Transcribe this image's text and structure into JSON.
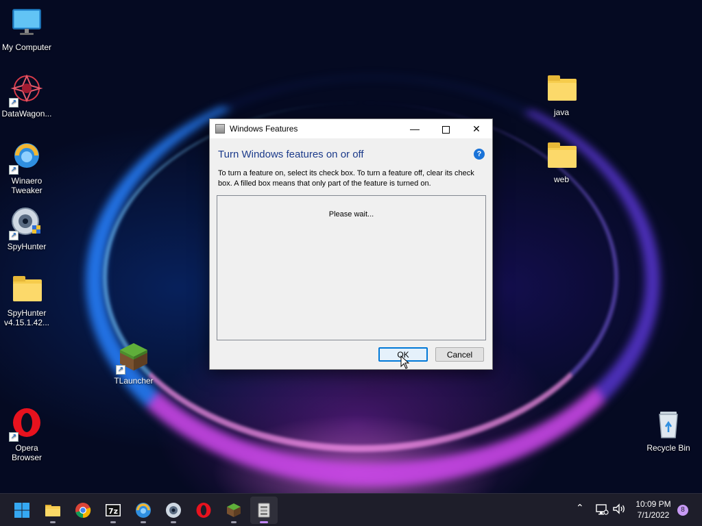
{
  "desktop": {
    "icons": [
      {
        "label": "My Computer",
        "icon": "monitor-icon"
      },
      {
        "label": "DataWagon...",
        "icon": "datawagon-icon"
      },
      {
        "label": "Winaero Tweaker",
        "icon": "winaero-icon"
      },
      {
        "label": "SpyHunter",
        "icon": "spyhunter-icon"
      },
      {
        "label": "SpyHunter v4.15.1.42...",
        "icon": "folder-icon"
      },
      {
        "label": "TLauncher",
        "icon": "grass-block-icon"
      },
      {
        "label": "Opera Browser",
        "icon": "opera-icon"
      },
      {
        "label": "java",
        "icon": "folder-icon"
      },
      {
        "label": "web",
        "icon": "folder-icon"
      },
      {
        "label": "Recycle Bin",
        "icon": "recycle-bin-icon"
      }
    ]
  },
  "dialog": {
    "title": "Windows Features",
    "heading": "Turn Windows features on or off",
    "help": "?",
    "description": "To turn a feature on, select its check box. To turn a feature off, clear its check box. A filled box means that only part of the feature is turned on.",
    "loading_text": "Please wait...",
    "ok_label": "OK",
    "cancel_label": "Cancel"
  },
  "taskbar": {
    "apps": [
      {
        "name": "start",
        "icon": "windows-start-icon"
      },
      {
        "name": "file-explorer",
        "icon": "folder-icon"
      },
      {
        "name": "chrome",
        "icon": "chrome-icon"
      },
      {
        "name": "7zip",
        "icon": "7zip-icon",
        "text": "7z"
      },
      {
        "name": "winaero",
        "icon": "winaero-icon"
      },
      {
        "name": "spyhunter",
        "icon": "spyhunter-icon"
      },
      {
        "name": "opera",
        "icon": "opera-icon"
      },
      {
        "name": "tlauncher",
        "icon": "grass-block-icon"
      },
      {
        "name": "windows-features",
        "icon": "windows-features-icon",
        "active": true
      }
    ],
    "tray": {
      "time": "10:09 PM",
      "date": "7/1/2022",
      "notifications": "8"
    }
  },
  "colors": {
    "accent": "#0078d7",
    "heading": "#1b3a8a",
    "taskbar": "#1e1e2a"
  }
}
